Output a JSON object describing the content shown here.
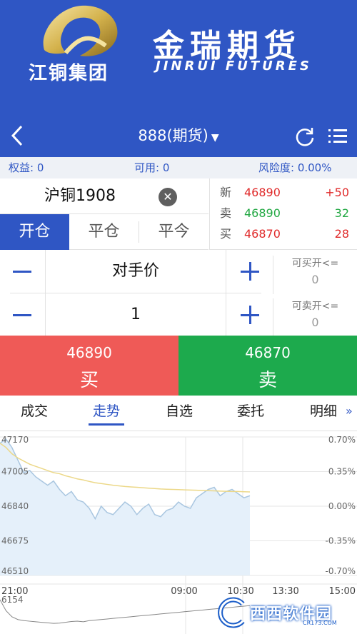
{
  "banner": {
    "group_name": "江铜集团",
    "brand_cn": "金瑞期货",
    "brand_en": "JINRUI FUTURES"
  },
  "nav": {
    "title": "888(期货)",
    "caret": "▼"
  },
  "account": {
    "equity_label": "权益: 0",
    "available_label": "可用: 0",
    "risk_label": "风险度: 0.00%"
  },
  "order": {
    "contract": "沪铜1908",
    "clear_icon": "✕",
    "tabs": [
      "开仓",
      "平仓",
      "平今"
    ],
    "active_tab": 0,
    "price_mode": "对手价",
    "quantity": "1",
    "can_buy_label": "可买开<=",
    "can_buy_value": "0",
    "can_sell_label": "可卖开<=",
    "can_sell_value": "0"
  },
  "quote": {
    "last": {
      "label": "新",
      "price": "46890",
      "value": "+50"
    },
    "ask": {
      "label": "卖",
      "price": "46890",
      "value": "32"
    },
    "bid": {
      "label": "买",
      "price": "46870",
      "value": "28"
    }
  },
  "buttons": {
    "buy_price": "46890",
    "buy_label": "买",
    "sell_price": "46870",
    "sell_label": "卖"
  },
  "bottom_tabs": [
    "成交",
    "走势",
    "自选",
    "委托",
    "明细"
  ],
  "bottom_tabs_active": 1,
  "bottom_tabs_more": "»",
  "watermark": {
    "text": "西西软件园",
    "url": "CR173.COM"
  },
  "colors": {
    "brand_blue": "#2f56c4",
    "up_red": "#e02a2a",
    "down_green": "#22a843",
    "buy_bg": "#ef5a57",
    "sell_bg": "#1daa4d",
    "avg_line": "#ecd888",
    "price_line": "#a9c6e0"
  },
  "icons": [
    "back-arrow-icon",
    "refresh-icon",
    "menu-list-icon",
    "clear-icon",
    "minus-icon",
    "plus-icon",
    "more-icon"
  ],
  "chart_data": {
    "type": "area",
    "price_ticks": [
      "47170",
      "47005",
      "46840",
      "46675",
      "46510"
    ],
    "pct_ticks": [
      "0.70%",
      "0.35%",
      "0.00%",
      "-0.35%",
      "-0.70%"
    ],
    "time_ticks": [
      "21:00",
      "09:00",
      "10:30",
      "13:30",
      "15:00"
    ],
    "volume_label": "6154",
    "ylim": [
      46510,
      47170
    ],
    "x_slots": 180,
    "x": [
      0,
      3,
      6,
      9,
      12,
      15,
      18,
      21,
      24,
      27,
      30,
      33,
      36,
      39,
      42,
      45,
      48,
      51,
      54,
      57,
      60,
      63,
      66,
      69,
      72,
      75,
      78,
      81,
      84,
      87,
      90,
      93,
      96,
      99,
      102,
      105,
      108,
      111,
      114,
      117,
      120,
      123,
      126
    ],
    "price": [
      47140,
      47160,
      47120,
      47060,
      47000,
      47010,
      46980,
      46960,
      46940,
      46960,
      46920,
      46890,
      46910,
      46870,
      46860,
      46830,
      46780,
      46840,
      46810,
      46800,
      46830,
      46860,
      46840,
      46800,
      46830,
      46850,
      46800,
      46790,
      46820,
      46830,
      46860,
      46840,
      46830,
      46880,
      46900,
      46920,
      46930,
      46890,
      46910,
      46920,
      46900,
      46880,
      46890
    ],
    "avg": [
      47140,
      47120,
      47090,
      47070,
      47055,
      47040,
      47030,
      47020,
      47010,
      47000,
      46995,
      46985,
      46978,
      46970,
      46965,
      46958,
      46952,
      46948,
      46944,
      46940,
      46937,
      46934,
      46932,
      46930,
      46928,
      46926,
      46924,
      46922,
      46921,
      46920,
      46919,
      46918,
      46917,
      46916,
      46915,
      46914,
      46913,
      46912,
      46911,
      46910,
      46910,
      46909,
      46908
    ],
    "volume": [
      6154,
      4200,
      3100,
      2600,
      2400,
      2300,
      2200,
      2100,
      2000,
      1900,
      1950,
      2100,
      2250,
      2300,
      2200,
      2400,
      2500,
      2600,
      2700,
      2800,
      2900,
      3000,
      3100,
      3200,
      3300,
      3400,
      3500,
      3600,
      3700,
      3800,
      3900,
      4000,
      4100,
      4200,
      4300,
      4400,
      4500,
      4600,
      4700,
      4800,
      4900,
      5000,
      5100
    ],
    "grid": true
  }
}
